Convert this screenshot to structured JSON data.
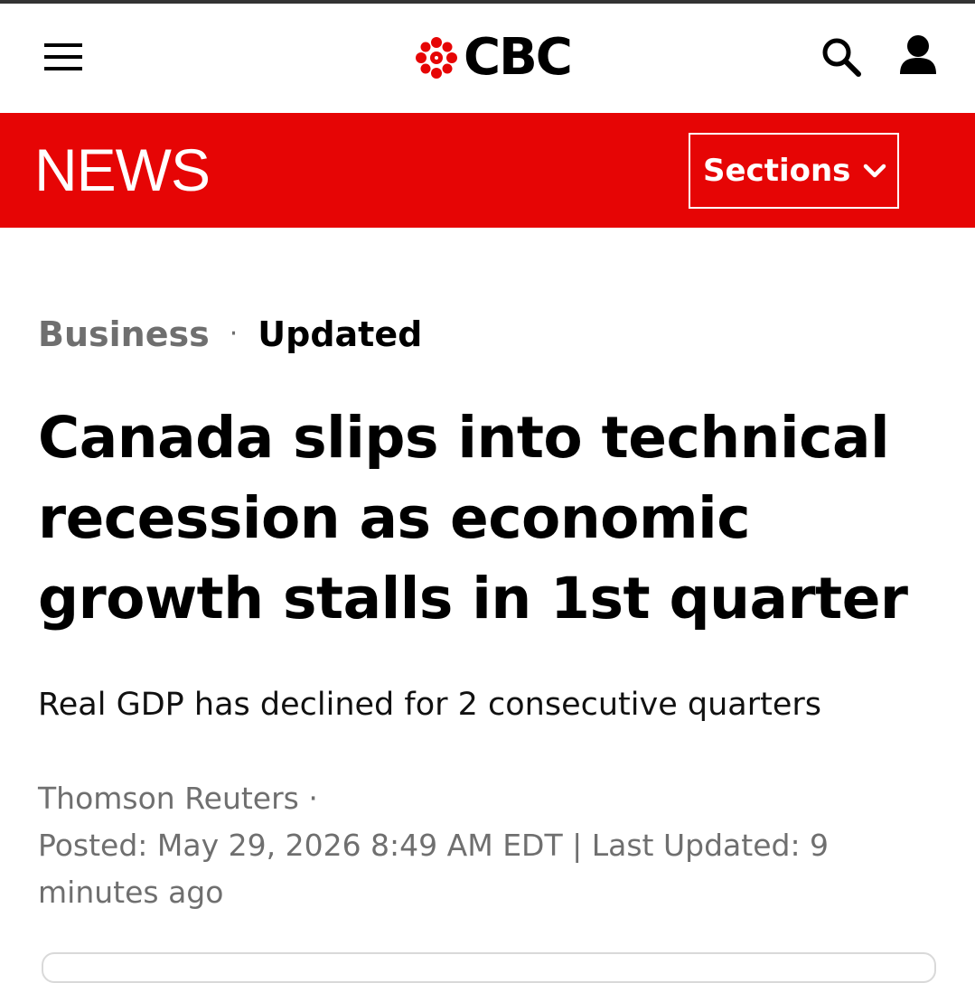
{
  "header": {
    "logo_text": "CBC",
    "icons": {
      "menu": "hamburger-menu-icon",
      "logo": "cbc-gem-icon",
      "search": "search-icon",
      "account": "account-icon"
    },
    "colors": {
      "logo_red": "#e60505"
    }
  },
  "news_bar": {
    "title": "NEWS",
    "sections_label": "Sections",
    "sections_icon": "chevron-down-icon",
    "colors": {
      "background": "#e60505",
      "text": "#ffffff"
    }
  },
  "article": {
    "category": "Business",
    "separator": "·",
    "status": "Updated",
    "headline": "Canada slips into technical recession as economic growth stalls in 1st quarter",
    "deck": "Real GDP has declined for 2 consecutive quarters",
    "author": "Thomson Reuters",
    "author_separator": "·",
    "posted": "Posted: May 29, 2026 8:49 AM EDT",
    "updated_separator": "|",
    "last_updated": "Last Updated: 9 minutes ago"
  }
}
